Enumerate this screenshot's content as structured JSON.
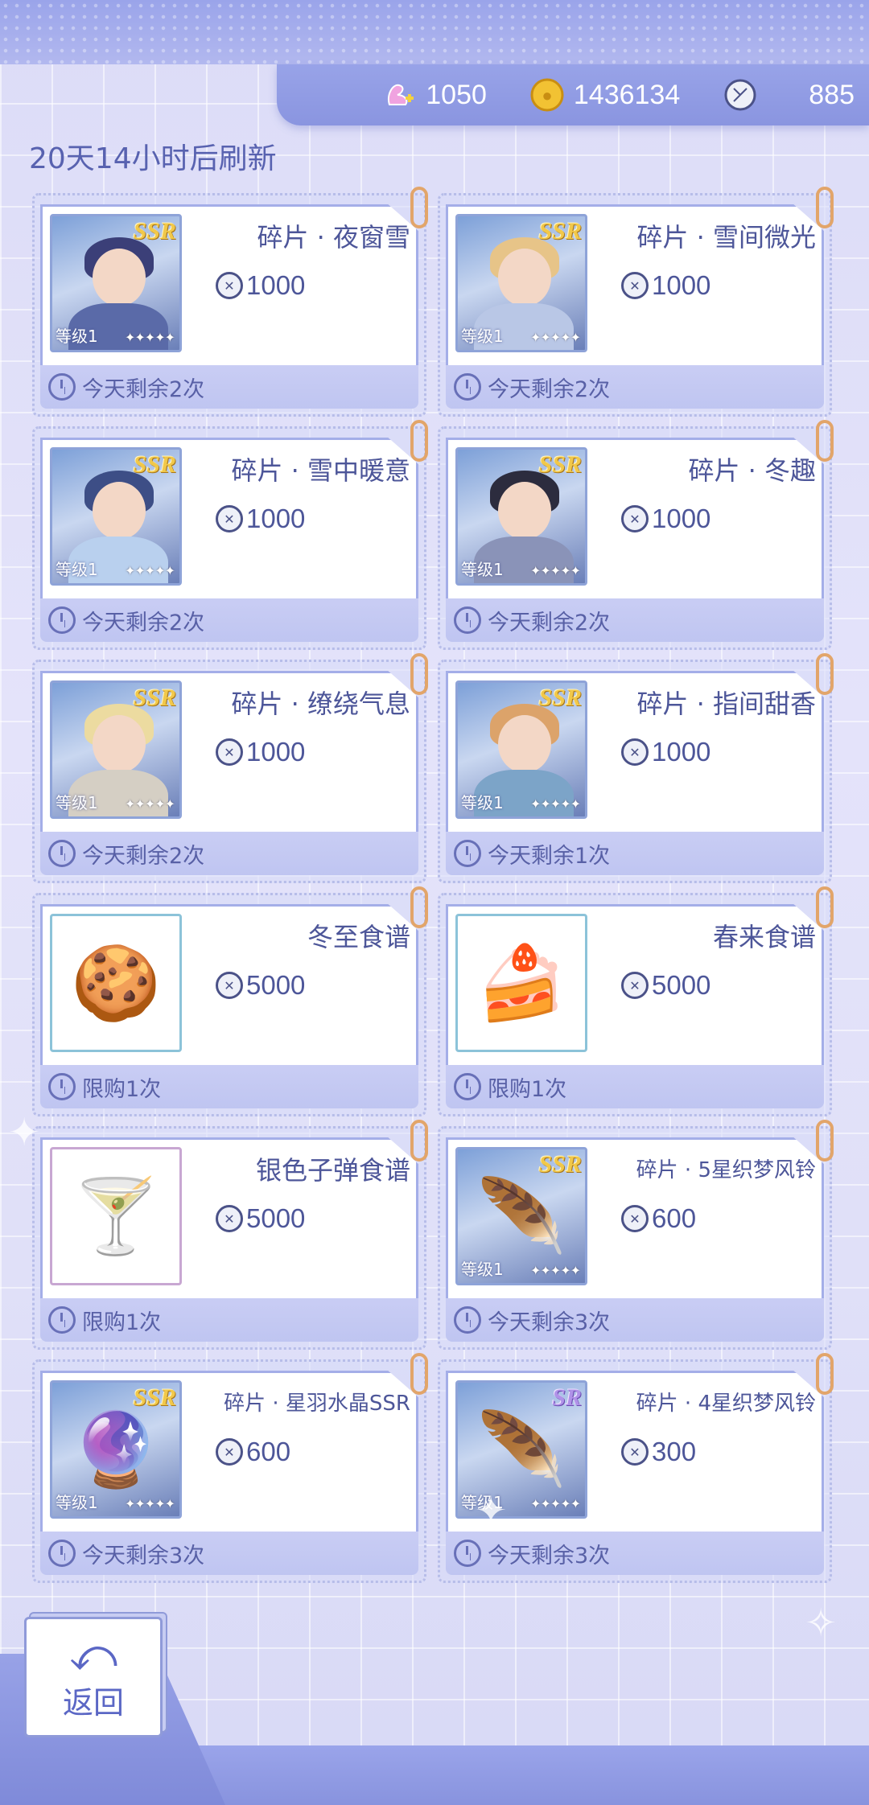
{
  "currency": [
    {
      "name": "swan-gem-icon",
      "value": "1050"
    },
    {
      "name": "gold-coin-icon",
      "value": "1436134"
    },
    {
      "name": "compass-token-icon",
      "value": "885"
    }
  ],
  "refresh_text": "20天14小时后刷新",
  "items": [
    {
      "title": "碎片 · 夜窗雪",
      "price": "1000",
      "footer": "今天剩余2次",
      "badge": "SSR",
      "level": "等级1",
      "kind": "portrait",
      "hair": "#3b3f78",
      "body": "#5a6aa8"
    },
    {
      "title": "碎片 · 雪间微光",
      "price": "1000",
      "footer": "今天剩余2次",
      "badge": "SSR",
      "level": "等级1",
      "kind": "portrait",
      "hair": "#e7c488",
      "body": "#b9c7e6"
    },
    {
      "title": "碎片 · 雪中暖意",
      "price": "1000",
      "footer": "今天剩余2次",
      "badge": "SSR",
      "level": "等级1",
      "kind": "portrait",
      "hair": "#3d4e86",
      "body": "#b9d0ee"
    },
    {
      "title": "碎片 · 冬趣",
      "price": "1000",
      "footer": "今天剩余2次",
      "badge": "SSR",
      "level": "等级1",
      "kind": "portrait",
      "hair": "#2c2c3e",
      "body": "#8a93b8"
    },
    {
      "title": "碎片 · 缭绕气息",
      "price": "1000",
      "footer": "今天剩余2次",
      "badge": "SSR",
      "level": "等级1",
      "kind": "portrait",
      "hair": "#ecdba0",
      "body": "#d5cfc4"
    },
    {
      "title": "碎片 · 指间甜香",
      "price": "1000",
      "footer": "今天剩余1次",
      "badge": "SSR",
      "level": "等级1",
      "kind": "portrait",
      "hair": "#dca36a",
      "body": "#7ca4c8"
    },
    {
      "title": "冬至食谱",
      "price": "5000",
      "footer": "限购1次",
      "badge": "",
      "level": "",
      "kind": "food",
      "emoji": "🍪"
    },
    {
      "title": "春来食谱",
      "price": "5000",
      "footer": "限购1次",
      "badge": "",
      "level": "",
      "kind": "food",
      "emoji": "🍰"
    },
    {
      "title": "银色子弹食谱",
      "price": "5000",
      "footer": "限购1次",
      "badge": "",
      "level": "",
      "kind": "food2",
      "emoji": "🍸"
    },
    {
      "title": "碎片 · 5星织梦风铃",
      "price": "600",
      "footer": "今天剩余3次",
      "badge": "SSR",
      "level": "等级1",
      "kind": "object",
      "emoji": "🪶",
      "small": true
    },
    {
      "title": "碎片 · 星羽水晶SSR",
      "price": "600",
      "footer": "今天剩余3次",
      "badge": "SSR",
      "level": "等级1",
      "kind": "object",
      "emoji": "🔮",
      "small": true
    },
    {
      "title": "碎片 · 4星织梦风铃",
      "price": "300",
      "footer": "今天剩余3次",
      "badge": "SR",
      "level": "等级1",
      "kind": "object",
      "emoji": "🪶",
      "small": true
    }
  ],
  "back_label": "返回"
}
